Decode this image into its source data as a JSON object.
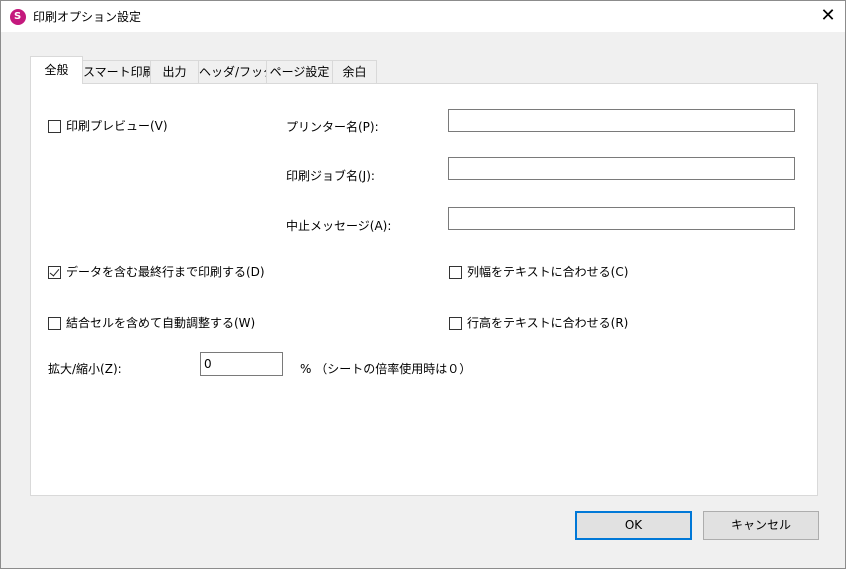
{
  "window": {
    "title": "印刷オプション設定",
    "app_icon_glyph": "S",
    "close_glyph": "✕"
  },
  "tabs": [
    {
      "label": "全般",
      "active": true
    },
    {
      "label": "スマート印刷",
      "active": false
    },
    {
      "label": "出力",
      "active": false
    },
    {
      "label": "ヘッダ/フッタ",
      "active": false
    },
    {
      "label": "ページ設定",
      "active": false
    },
    {
      "label": "余白",
      "active": false
    }
  ],
  "general": {
    "print_preview": {
      "label": "印刷プレビュー(V)",
      "checked": false
    },
    "printer_name": {
      "label": "プリンター名(P):",
      "value": ""
    },
    "print_job_name": {
      "label": "印刷ジョブ名(J):",
      "value": ""
    },
    "abort_message": {
      "label": "中止メッセージ(A):",
      "value": ""
    },
    "print_to_last_row": {
      "label": "データを含む最終行まで印刷する(D)",
      "checked": true
    },
    "fit_column_width": {
      "label": "列幅をテキストに合わせる(C)",
      "checked": false
    },
    "auto_adjust_merged": {
      "label": "結合セルを含めて自動調整する(W)",
      "checked": false
    },
    "fit_row_height": {
      "label": "行高をテキストに合わせる(R)",
      "checked": false
    },
    "zoom": {
      "label": "拡大/縮小(Z):",
      "value": "0",
      "suffix": "%  （シートの倍率使用時は０）"
    }
  },
  "buttons": {
    "ok": "OK",
    "cancel": "キャンセル"
  }
}
